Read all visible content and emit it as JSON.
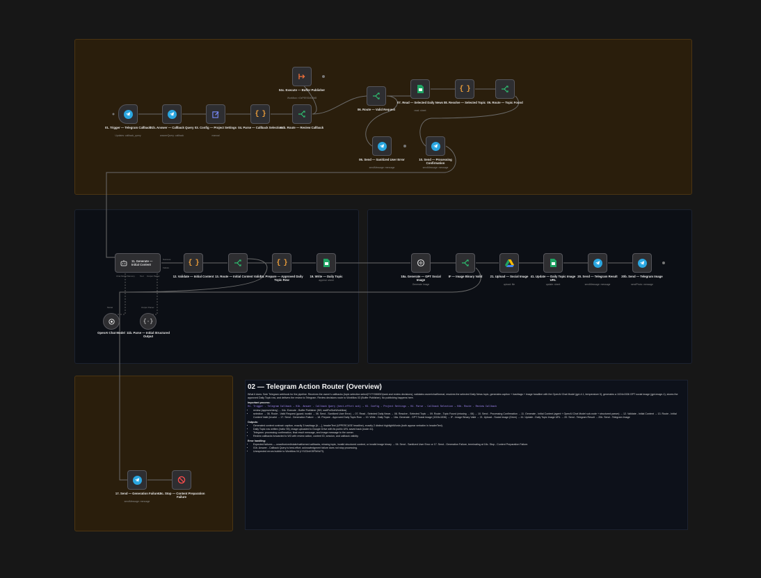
{
  "canvas": {
    "background": "#171717"
  },
  "colors": {
    "group_brown": "#2a1e0c",
    "group_navy": "#0c0f15",
    "telegram": "#2aa6e0",
    "router": "#2fbf71",
    "code": "#f0a03a",
    "wire": "#6b6b6b"
  },
  "nodes": {
    "n01": {
      "title": "01. Trigger — Telegram Callback",
      "sub": "Updates: callback_query",
      "icon": "telegram-icon"
    },
    "n01b": {
      "title": "01b. Answer — Callback Query",
      "sub": "answerQuery: callback",
      "icon": "telegram-icon"
    },
    "n03": {
      "title": "03. Config — Project Settings",
      "sub": "manual",
      "icon": "edit-icon"
    },
    "n04": {
      "title": "04. Parse — Callback Selection",
      "sub": "",
      "icon": "code-icon"
    },
    "n04b": {
      "title": "04b. Route — Review Callback",
      "sub": "",
      "icon": "router-icon"
    },
    "n04c": {
      "title": "04c. Execute — Buffer Publisher",
      "sub": "Workflow: n7aP9EfGkK8W8",
      "icon": "execute-workflow-icon"
    },
    "n06": {
      "title": "06. Route — Valid Request",
      "sub": "",
      "icon": "router-icon"
    },
    "n07": {
      "title": "07. Read — Selected Daily News",
      "sub": "read: sheet",
      "icon": "sheets-icon"
    },
    "n08": {
      "title": "08. Resolve — Selected Topic",
      "sub": "",
      "icon": "code-icon"
    },
    "n09": {
      "title": "09. Route — Topic Found",
      "sub": "",
      "icon": "router-icon"
    },
    "n06b": {
      "title": "06. Send — Sanitized User Error",
      "sub": "sendMessage: message",
      "icon": "telegram-icon"
    },
    "n10": {
      "title": "10. Send — Processing Confirmation",
      "sub": "sendMessage: message",
      "icon": "telegram-icon"
    },
    "n11": {
      "title": "11. Generate — Initial Content",
      "sub": "",
      "icon": "ai-agent-icon",
      "ports": [
        "Chat Model",
        "Memory",
        "Tool",
        "Output Parser"
      ]
    },
    "n12": {
      "title": "12. Validate — Initial Content",
      "sub": "",
      "icon": "code-icon"
    },
    "n13": {
      "title": "13. Route — Initial Content Valid",
      "sub": "",
      "icon": "router-icon"
    },
    "n16": {
      "title": "16. Prepare — Approved Daily Topic Row",
      "sub": "",
      "icon": "code-icon"
    },
    "n19": {
      "title": "19. Write — Daily Topic",
      "sub": "append: sheet",
      "icon": "sheets-icon"
    },
    "n18a": {
      "title": "18a. Generate — GPT Social Image",
      "sub": "Generate Image",
      "icon": "openai-icon"
    },
    "nIF": {
      "title": "IF — Image Binary Valid",
      "sub": "",
      "icon": "router-icon"
    },
    "n21": {
      "title": "21. Upload — Social Image",
      "sub": "upload: file",
      "icon": "drive-icon"
    },
    "n41": {
      "title": "41. Update — Daily Topic Image URL",
      "sub": "update: sheet",
      "icon": "sheets-icon"
    },
    "n20": {
      "title": "20. Send — Telegram Result",
      "sub": "sendMessage: message",
      "icon": "telegram-icon"
    },
    "n20b": {
      "title": "20b. Send — Telegram Image",
      "sub": "sendPhoto: message",
      "icon": "telegram-icon"
    },
    "nModel": {
      "title": "OpenAI Chat Model",
      "sub": "",
      "icon": "openai-icon",
      "top": "Model"
    },
    "n11b": {
      "title": "11b. Parse — Initial Structured Output",
      "sub": "",
      "icon": "parser-icon",
      "top": "Output Parser"
    },
    "n17": {
      "title": "17. Send — Generation Failure",
      "sub": "sendMessage: message",
      "icon": "telegram-icon"
    },
    "n18c": {
      "title": "18c. Stop — Content Preparation Failure",
      "sub": "",
      "icon": "stop-icon"
    }
  },
  "output_labels": {
    "success": "Success",
    "failure": "Failure"
  },
  "note": {
    "title": "02 — Telegram Action Router (Overview)",
    "intro": "What it does: Sole Telegram webhook for the pipeline. Receives the owner's callbacks (topic selection select|YYYYMMDD|rank and review decisions), validates owner/chat/format, resolves the selected Daily News topic, generates caption + hashtags + image headline with the OpenAI Chat Model (gpt-4.1, temperature 0), generates a 1024x1536 GPT social image (gpt-image-1), stores the approved Daily Topic row, and delivers the review to Telegram. Review decisions route to Workflow 03 (Buffer Publisher). No publishing happens here.",
    "process_h": "Important process:",
    "process_1": "01. Trigger - Telegram Callback → 01b. Answer - Callback Query (best-effort ack) → 03. Config - Project Settings → 04. Parse - Callback Selection → 04b. Route - Review Callback",
    "bullets": [
      "review (approve/deny) → 04c. Execute - Buffer Publisher (W3, waitForSubWorkflow)",
      "selection → 06. Route - Valid Request (guard; invalid → 06. Send - Sanitized User Error) → 07. Read - Selected Daily News → 08. Resolve - Selected Topic → 09. Route - Topic Found (missing → 06) → 10. Send - Processing Confirmation → 11. Generate - Initial Content (agent + OpenAI Chat Model sub-node + structured parser) → 12. Validate - Initial Content → 13. Route - Initial Content Valid (invalid → 17. Send - Generation Failure → 18. Prepare - Approved Daily Topic Row → 19. Write - Daily Topic → 18a. Generate - GPT Social Image (1024x1536) → IF - Image Binary Valid → 21. Upload - Social Image (Drive) → 41. Update - Daily Topic Image URL → 20. Send - Telegram Result → 20b. Send - Telegram Image"
    ],
    "outputs_h": "Outputs:",
    "outputs": [
      "Generated content contract: caption, exactly 3 hashtags [#..., ], headerText (UPPERCASE headline), exactly 2 distinct highlightWords (both appear verbatim in headerText).",
      "Daily Topic row written (/ratio '05); image uploaded to Google Drive with its public URL saved back (node 41).",
      "Telegram: processing confirmation, final result message, and image message to the owner.",
      "Review callbacks forwarded to W3 with review action, content ID, session, and callback validity."
    ],
    "errors_h": "Error handling:",
    "errors": [
      "Expected failures — unauthorized/stale/malformed callbacks, missing topic, invalid structured content, or invalid image binary → 06. Send - Sanitized User Error or 17. Send - Generation Failure, terminating at 18c. Stop - Content Preparation Failure.",
      "01b. Answer - Callback Query is best-effort; acknowledgment failure does not stop processing.",
      "Unexpected errors bubble to Workflow 04 (rYXZ2mKf0F5rNxTf)."
    ]
  }
}
